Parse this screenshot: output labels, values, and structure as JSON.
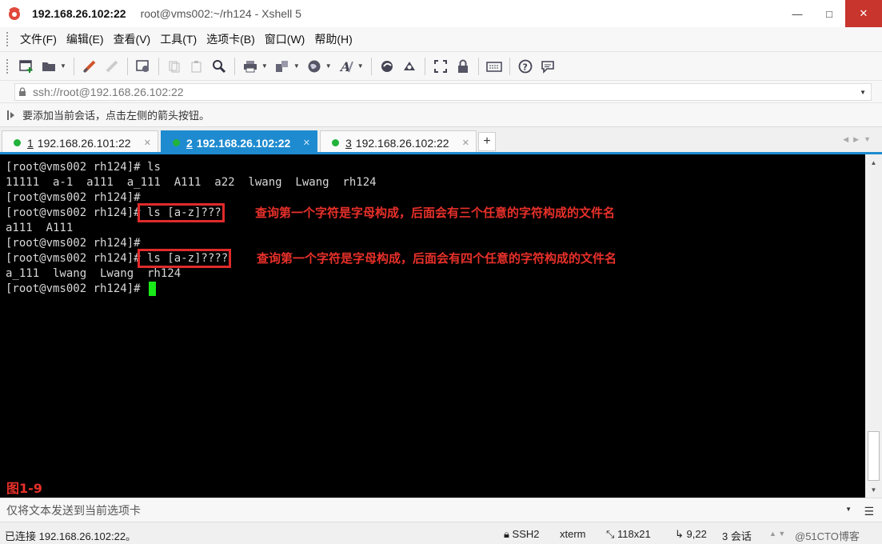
{
  "window": {
    "title_host": "192.168.26.102:22",
    "title_rest": "root@vms002:~/rh124 - Xshell 5",
    "minimize": "—",
    "maximize": "□",
    "close": "✕"
  },
  "menu": [
    "文件(F)",
    "编辑(E)",
    "查看(V)",
    "工具(T)",
    "选项卡(B)",
    "窗口(W)",
    "帮助(H)"
  ],
  "address": {
    "value": "ssh://root@192.168.26.102:22"
  },
  "hint": {
    "text": "要添加当前会话，点击左侧的箭头按钮。"
  },
  "tabs": [
    {
      "num": "1",
      "label": "192.168.26.101:22",
      "active": false
    },
    {
      "num": "2",
      "label": "192.168.26.102:22",
      "active": true
    },
    {
      "num": "3",
      "label": "192.168.26.102:22",
      "active": false
    }
  ],
  "terminal": {
    "lines": [
      {
        "prompt": "[root@vms002 rh124]# ",
        "cmd": "ls"
      },
      {
        "out": "11111  a-1  a111  a_111  A111  a22  lwang  Lwang  rh124"
      },
      {
        "prompt": "[root@vms002 rh124]# ",
        "cmd": ""
      },
      {
        "prompt": "[root@vms002 rh124]#",
        "cmd": " ls [a-z]???"
      },
      {
        "out": "a111  A111"
      },
      {
        "prompt": "[root@vms002 rh124]# ",
        "cmd": ""
      },
      {
        "prompt": "[root@vms002 rh124]#",
        "cmd": " ls [a-z]????"
      },
      {
        "out": "a_111  lwang  Lwang  rh124"
      },
      {
        "prompt": "[root@vms002 rh124]# ",
        "cmd": ""
      }
    ],
    "note1": "查询第一个字符是字母构成，后面会有三个任意的字符构成的文件名",
    "note2": "查询第一个字符是字母构成，后面会有四个任意的字符构成的文件名",
    "figure_label": "图1-9"
  },
  "send_bar": {
    "placeholder": "仅将文本发送到当前选项卡"
  },
  "status": {
    "connected": "已连接 192.168.26.102:22。",
    "protocol": "SSH2",
    "term": "xterm",
    "size": "118x21",
    "cursor_pos": "9,22",
    "sessions": "3 会话",
    "watermark": "@51CTO博客"
  },
  "colors": {
    "tab_active": "#1e8bd0",
    "annotation_red": "#e8302a",
    "cursor_green": "#19e819",
    "status_dot": "#21b33a"
  }
}
